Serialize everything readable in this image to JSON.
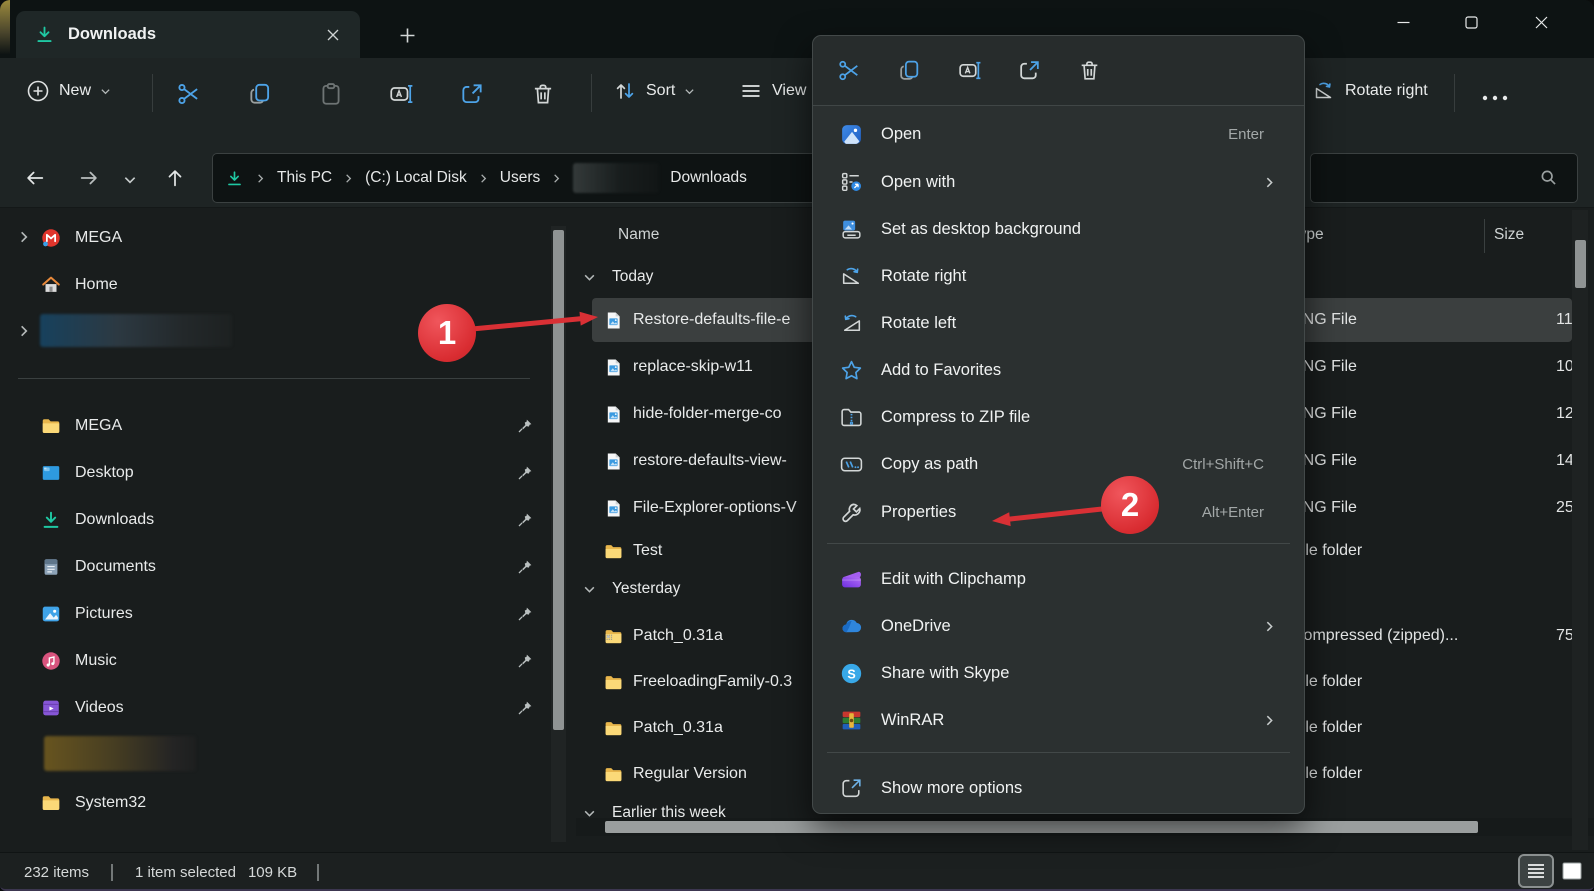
{
  "tab_bar": {
    "tab_label": "Downloads"
  },
  "toolbar": {
    "new_label": "New",
    "sort_label": "Sort",
    "view_label": "View",
    "rotate_right_label": "Rotate right"
  },
  "address_bar": {
    "crumb_this_pc": "This PC",
    "crumb_drive": "(C:) Local Disk",
    "crumb_users": "Users",
    "crumb_current": "Downloads"
  },
  "sidebar": {
    "items": [
      {
        "label": "MEGA"
      },
      {
        "label": "Home"
      },
      {
        "label": "MEGA"
      },
      {
        "label": "Desktop"
      },
      {
        "label": "Downloads"
      },
      {
        "label": "Documents"
      },
      {
        "label": "Pictures"
      },
      {
        "label": "Music"
      },
      {
        "label": "Videos"
      },
      {
        "label": "System32"
      }
    ]
  },
  "file_list": {
    "header_name": "Name",
    "header_type": "Type",
    "header_size": "Size",
    "group_today": "Today",
    "group_yesterday": "Yesterday",
    "group_earlier": "Earlier this week",
    "rows": [
      {
        "name": "Restore-defaults-file-e",
        "type": "PNG File",
        "size": "11"
      },
      {
        "name": "replace-skip-w11",
        "type": "PNG File",
        "size": "10"
      },
      {
        "name": "hide-folder-merge-co",
        "type": "PNG File",
        "size": "12"
      },
      {
        "name": "restore-defaults-view-",
        "type": "PNG File",
        "size": "14"
      },
      {
        "name": "File-Explorer-options-V",
        "type": "PNG File",
        "size": "25"
      },
      {
        "name": "Test",
        "type": "File folder",
        "size": ""
      },
      {
        "name": "Patch_0.31a",
        "type": "Compressed (zipped)...",
        "size": "75"
      },
      {
        "name": "FreeloadingFamily-0.3",
        "type": "File folder",
        "size": ""
      },
      {
        "name": "Patch_0.31a",
        "type": "File folder",
        "size": ""
      },
      {
        "name": "Regular Version",
        "type": "File folder",
        "size": ""
      }
    ]
  },
  "context_menu": {
    "open": "Open",
    "open_shortcut": "Enter",
    "open_with": "Open with",
    "set_background": "Set as desktop background",
    "rotate_right": "Rotate right",
    "rotate_left": "Rotate left",
    "add_favorites": "Add to Favorites",
    "compress_zip": "Compress to ZIP file",
    "copy_path": "Copy as path",
    "copy_path_shortcut": "Ctrl+Shift+C",
    "properties": "Properties",
    "properties_shortcut": "Alt+Enter",
    "clipchamp": "Edit with Clipchamp",
    "onedrive": "OneDrive",
    "skype": "Share with Skype",
    "winrar": "WinRAR",
    "show_more": "Show more options"
  },
  "status_bar": {
    "items_count": "232 items",
    "selected": "1 item selected",
    "selected_size": "109 KB"
  },
  "annotations": {
    "step1": "1",
    "step2": "2"
  }
}
